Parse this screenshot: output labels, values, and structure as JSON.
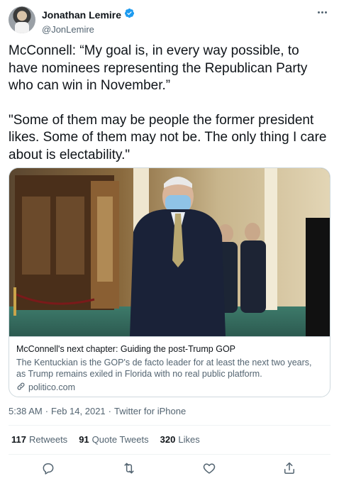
{
  "author": {
    "name": "Jonathan Lemire",
    "handle": "@JonLemire",
    "verified_icon": "verified-badge-icon"
  },
  "tweet": {
    "paragraph_1": "McConnell: “My goal is, in every way possible, to have nominees representing the Republican Party who can win in November.”",
    "paragraph_2": "\"Some of them may be people the former president likes. Some of them may not be. The only thing I care about is electability.\""
  },
  "card": {
    "title": "McConnell's next chapter: Guiding the post-Trump GOP",
    "description": "The Kentuckian is the GOP's de facto leader for at least the next two years, as Trump remains exiled in Florida with no real public platform.",
    "domain": "politico.com"
  },
  "meta": {
    "time": "5:38 AM",
    "separator": "·",
    "date": "Feb 14, 2021",
    "source": "Twitter for iPhone"
  },
  "stats": {
    "retweets_count": "117",
    "retweets_label": "Retweets",
    "quotes_count": "91",
    "quotes_label": "Quote Tweets",
    "likes_count": "320",
    "likes_label": "Likes"
  },
  "colors": {
    "text": "#0f1419",
    "secondary": "#536471",
    "verified": "#1d9bf0",
    "border": "#cfd9de"
  }
}
